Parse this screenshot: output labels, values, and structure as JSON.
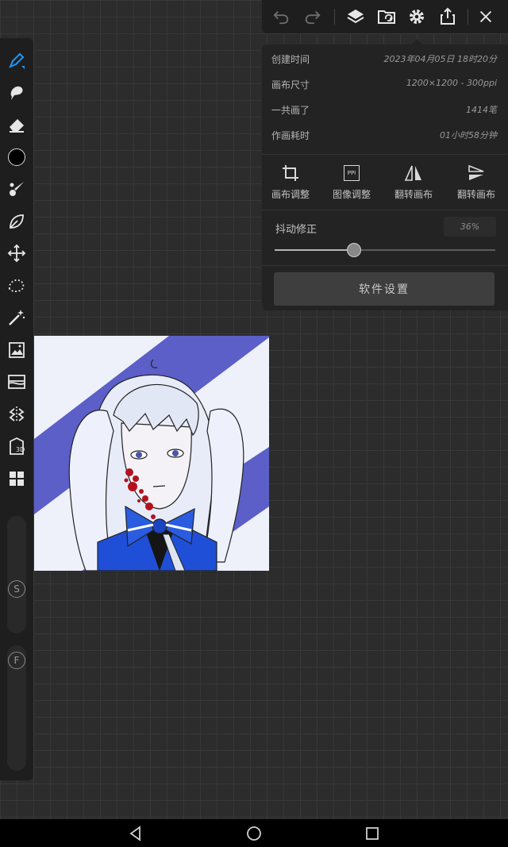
{
  "toolbar": {
    "undo": "undo-icon",
    "redo": "redo-icon",
    "layers": "layers-icon",
    "files": "folder-icon",
    "settings": "gear-icon",
    "share": "share-icon",
    "close": "close-icon"
  },
  "info": {
    "rows": [
      {
        "label": "创建时间",
        "value": "2023年04月05日 18时20分"
      },
      {
        "label": "画布尺寸",
        "value": "1200×1200 - 300ppi"
      },
      {
        "label": "一共画了",
        "value": "1414笔"
      },
      {
        "label": "作画耗时",
        "value": "01小时58分钟"
      }
    ]
  },
  "actions": [
    {
      "label": "画布调整",
      "icon": "crop-icon"
    },
    {
      "label": "图像调整",
      "icon": "ppi-icon",
      "icon_text": "PPI"
    },
    {
      "label": "翻转画布",
      "icon": "flip-horizontal-icon"
    },
    {
      "label": "翻转画布",
      "icon": "flip-vertical-icon"
    }
  ],
  "stabilizer": {
    "label": "抖动修正",
    "value_text": "36%",
    "value": 0.36
  },
  "settings_button": "软件设置",
  "sidebar": {
    "tools": [
      "pen-icon",
      "smudge-icon",
      "eraser-icon",
      "color-swatch",
      "brush-icon",
      "leaf-icon",
      "move-icon",
      "lasso-icon",
      "magic-wand-icon",
      "image-icon",
      "layer-blend-icon",
      "symmetry-icon",
      "3d-icon",
      "grid-icon"
    ],
    "slider_labels": {
      "size": "S",
      "flow": "F"
    }
  },
  "colors": {
    "accent": "#2196f3",
    "stripe": "#5b5fc7",
    "bow": "#1f4fd6"
  }
}
